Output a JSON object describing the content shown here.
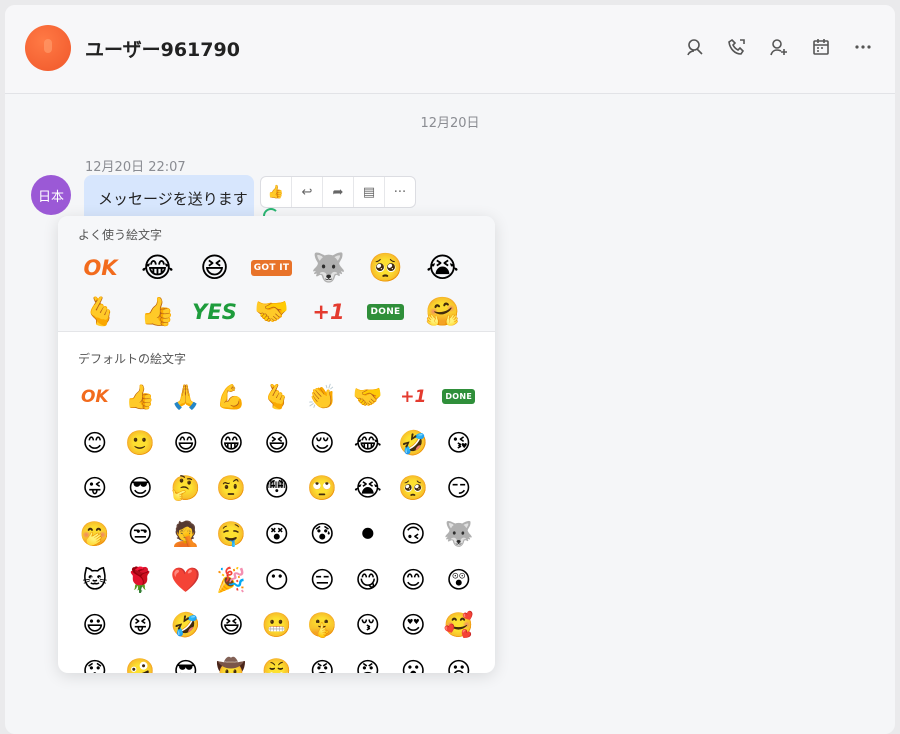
{
  "header": {
    "title": "ユーザー961790",
    "icons": [
      "search-user-icon",
      "phone-icon",
      "add-user-icon",
      "calendar-icon",
      "more-icon"
    ]
  },
  "chat": {
    "date_separator": "12月20日",
    "message": {
      "sender_initials": "日本",
      "time": "12月20日 22:07",
      "text": "メッセージを送ります"
    },
    "actions": [
      {
        "name": "like-button",
        "icon": "thumbs-up-icon",
        "glyph": "👍"
      },
      {
        "name": "reply-button",
        "icon": "reply-icon",
        "glyph": "↩"
      },
      {
        "name": "forward-button",
        "icon": "forward-icon",
        "glyph": "➦"
      },
      {
        "name": "quote-button",
        "icon": "quote-icon",
        "glyph": "▤"
      },
      {
        "name": "more-button",
        "icon": "more-icon",
        "glyph": "···"
      }
    ]
  },
  "emoji_picker": {
    "frequent_title": "よく使う絵文字",
    "default_title": "デフォルトの絵文字",
    "frequent": [
      {
        "kind": "text",
        "label": "OK",
        "color": "#f26b1d"
      },
      {
        "kind": "emoji",
        "label": "😂"
      },
      {
        "kind": "emoji",
        "label": "😆"
      },
      {
        "kind": "sticker",
        "label": "GOT IT",
        "color": "#e8732a"
      },
      {
        "kind": "emoji",
        "label": "🐺"
      },
      {
        "kind": "emoji",
        "label": "🥺"
      },
      {
        "kind": "emoji",
        "label": "😭"
      },
      {
        "kind": "emoji",
        "label": "🫰"
      },
      {
        "kind": "emoji",
        "label": "👍"
      },
      {
        "kind": "text",
        "label": "YES",
        "color": "#1e9c3c"
      },
      {
        "kind": "emoji",
        "label": "🤝"
      },
      {
        "kind": "text",
        "label": "+1",
        "color": "#e43b2f"
      },
      {
        "kind": "sticker",
        "label": "DONE",
        "color": "#2f8f3a"
      },
      {
        "kind": "emoji",
        "label": "🤗"
      }
    ],
    "default": [
      {
        "kind": "text",
        "label": "OK",
        "color": "#f26b1d"
      },
      {
        "kind": "emoji",
        "label": "👍"
      },
      {
        "kind": "emoji",
        "label": "🙏"
      },
      {
        "kind": "emoji",
        "label": "💪"
      },
      {
        "kind": "emoji",
        "label": "🫰"
      },
      {
        "kind": "emoji",
        "label": "👏"
      },
      {
        "kind": "emoji",
        "label": "🤝"
      },
      {
        "kind": "text",
        "label": "+1",
        "color": "#e43b2f"
      },
      {
        "kind": "sticker",
        "label": "DONE",
        "color": "#2f8f3a"
      },
      {
        "kind": "emoji",
        "label": "😊"
      },
      {
        "kind": "emoji",
        "label": "🙂"
      },
      {
        "kind": "emoji",
        "label": "😄"
      },
      {
        "kind": "emoji",
        "label": "😁"
      },
      {
        "kind": "emoji",
        "label": "😆"
      },
      {
        "kind": "emoji",
        "label": "😌"
      },
      {
        "kind": "emoji",
        "label": "😂"
      },
      {
        "kind": "emoji",
        "label": "🤣"
      },
      {
        "kind": "emoji",
        "label": "😘"
      },
      {
        "kind": "emoji",
        "label": "😜"
      },
      {
        "kind": "emoji",
        "label": "😎"
      },
      {
        "kind": "emoji",
        "label": "🤔"
      },
      {
        "kind": "emoji",
        "label": "🤨"
      },
      {
        "kind": "emoji",
        "label": "😳"
      },
      {
        "kind": "emoji",
        "label": "🙄"
      },
      {
        "kind": "emoji",
        "label": "😭"
      },
      {
        "kind": "emoji",
        "label": "🥺"
      },
      {
        "kind": "emoji",
        "label": "😏"
      },
      {
        "kind": "emoji",
        "label": "🤭"
      },
      {
        "kind": "emoji",
        "label": "😒"
      },
      {
        "kind": "emoji",
        "label": "🤦"
      },
      {
        "kind": "emoji",
        "label": "🤤"
      },
      {
        "kind": "emoji",
        "label": "😵"
      },
      {
        "kind": "emoji",
        "label": "😰"
      },
      {
        "kind": "emoji",
        "label": "⚫"
      },
      {
        "kind": "emoji",
        "label": "🙃"
      },
      {
        "kind": "emoji",
        "label": "🐺"
      },
      {
        "kind": "emoji",
        "label": "🐱"
      },
      {
        "kind": "emoji",
        "label": "🌹"
      },
      {
        "kind": "emoji",
        "label": "❤️"
      },
      {
        "kind": "emoji",
        "label": "🎉"
      },
      {
        "kind": "emoji",
        "label": "😶"
      },
      {
        "kind": "emoji",
        "label": "😑"
      },
      {
        "kind": "emoji",
        "label": "😋"
      },
      {
        "kind": "emoji",
        "label": "😊"
      },
      {
        "kind": "emoji",
        "label": "😲"
      },
      {
        "kind": "emoji",
        "label": "😃"
      },
      {
        "kind": "emoji",
        "label": "😝"
      },
      {
        "kind": "emoji",
        "label": "🤣"
      },
      {
        "kind": "emoji",
        "label": "😆"
      },
      {
        "kind": "emoji",
        "label": "😬"
      },
      {
        "kind": "emoji",
        "label": "🤫"
      },
      {
        "kind": "emoji",
        "label": "😚"
      },
      {
        "kind": "emoji",
        "label": "😍"
      },
      {
        "kind": "emoji",
        "label": "🥰"
      },
      {
        "kind": "emoji",
        "label": "😯"
      },
      {
        "kind": "emoji",
        "label": "🤪"
      },
      {
        "kind": "emoji",
        "label": "😎"
      },
      {
        "kind": "emoji",
        "label": "🤠"
      },
      {
        "kind": "emoji",
        "label": "😤"
      },
      {
        "kind": "emoji",
        "label": "😠"
      },
      {
        "kind": "emoji",
        "label": "😡"
      },
      {
        "kind": "emoji",
        "label": "😮"
      },
      {
        "kind": "emoji",
        "label": "😦"
      }
    ]
  }
}
